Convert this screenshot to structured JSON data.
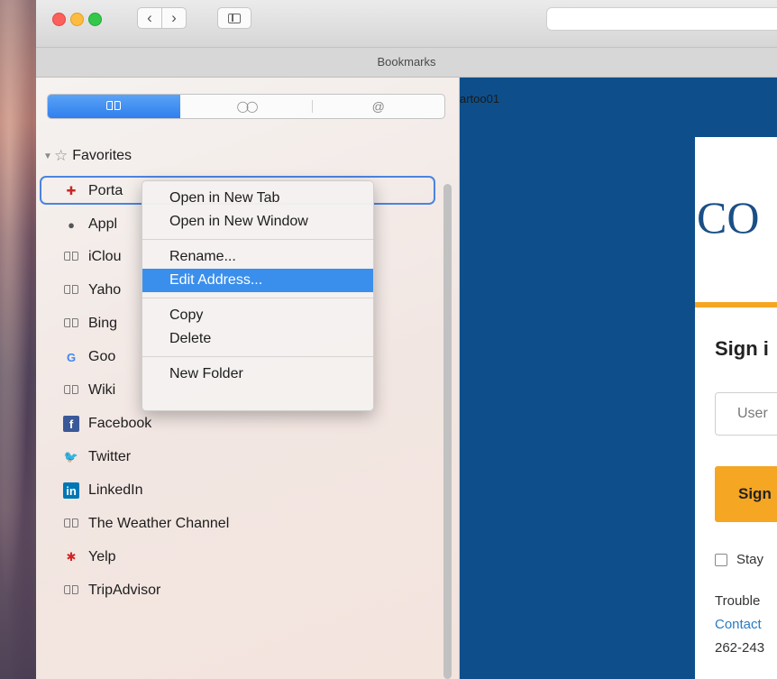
{
  "window": {
    "title": "Bookmarks",
    "nav": {
      "back_icon": "chevron-left-icon",
      "forward_icon": "chevron-right-icon"
    }
  },
  "sidebar": {
    "tabs": [
      {
        "icon": "book-icon",
        "active": true
      },
      {
        "icon": "glasses-icon",
        "glyph": "◯◯",
        "active": false
      },
      {
        "icon": "at-icon",
        "glyph": "@",
        "active": false
      }
    ],
    "favorites_label": "Favorites",
    "items": [
      {
        "label": "Porta",
        "icon": "portal-icon"
      },
      {
        "label": "Appl",
        "icon": "apple-icon"
      },
      {
        "label": "iClou",
        "icon": "book-icon"
      },
      {
        "label": "Yaho",
        "icon": "book-icon"
      },
      {
        "label": "Bing",
        "icon": "book-icon"
      },
      {
        "label": "Goo",
        "icon": "google-icon"
      },
      {
        "label": "Wiki",
        "icon": "book-icon"
      },
      {
        "label": "Facebook",
        "icon": "facebook-icon"
      },
      {
        "label": "Twitter",
        "icon": "twitter-icon"
      },
      {
        "label": "LinkedIn",
        "icon": "linkedin-icon"
      },
      {
        "label": "The Weather Channel",
        "icon": "book-icon"
      },
      {
        "label": "Yelp",
        "icon": "yelp-icon"
      },
      {
        "label": "TripAdvisor",
        "icon": "book-icon"
      }
    ]
  },
  "context_menu": {
    "groups": [
      [
        "Open in New Tab",
        "Open in New Window"
      ],
      [
        "Rename...",
        "Edit Address..."
      ],
      [
        "Copy",
        "Delete"
      ],
      [
        "New Folder"
      ]
    ],
    "highlighted": "Edit Address..."
  },
  "page": {
    "user_text": "artoo01",
    "logo_text": "CO",
    "signin_heading": "Sign i",
    "username_placeholder": "User",
    "signin_button": "Sign",
    "stay_label": "Stay",
    "trouble_text": "Trouble",
    "contact_link": "Contact",
    "phone_text": "262-243"
  },
  "colors": {
    "accent": "#2f7fee",
    "page_bg": "#0e4f8b",
    "orange": "#f5a623"
  }
}
